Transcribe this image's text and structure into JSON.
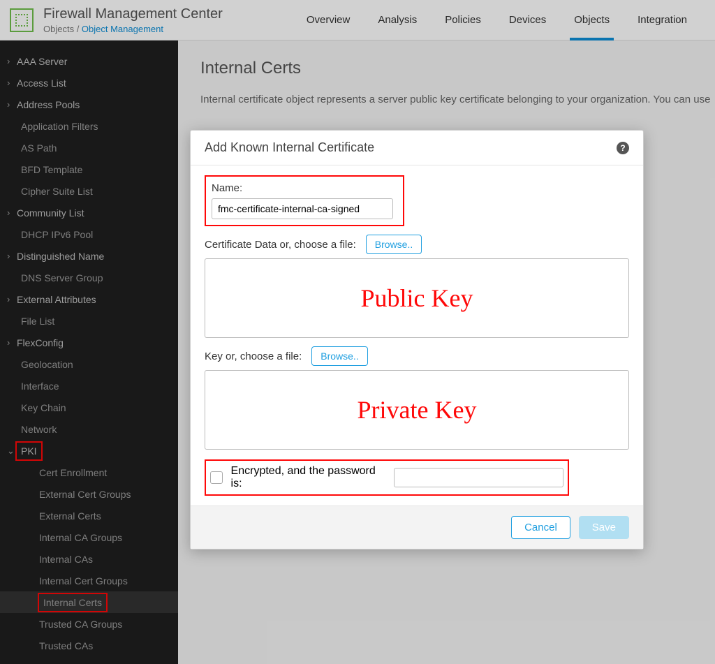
{
  "header": {
    "app_title": "Firewall Management Center",
    "crumb1": "Objects",
    "crumb_sep": " / ",
    "crumb2": "Object Management",
    "tabs": [
      "Overview",
      "Analysis",
      "Policies",
      "Devices",
      "Objects",
      "Integration"
    ],
    "active_tab": "Objects"
  },
  "sidenav": [
    {
      "label": "AAA Server",
      "level": 0,
      "arrow": ">"
    },
    {
      "label": "Access List",
      "level": 0,
      "arrow": ">"
    },
    {
      "label": "Address Pools",
      "level": 0,
      "arrow": ">"
    },
    {
      "label": "Application Filters",
      "level": 1
    },
    {
      "label": "AS Path",
      "level": 1
    },
    {
      "label": "BFD Template",
      "level": 1
    },
    {
      "label": "Cipher Suite List",
      "level": 1
    },
    {
      "label": "Community List",
      "level": 0,
      "arrow": ">"
    },
    {
      "label": "DHCP IPv6 Pool",
      "level": 1
    },
    {
      "label": "Distinguished Name",
      "level": 0,
      "arrow": ">"
    },
    {
      "label": "DNS Server Group",
      "level": 1
    },
    {
      "label": "External Attributes",
      "level": 0,
      "arrow": ">"
    },
    {
      "label": "File List",
      "level": 1
    },
    {
      "label": "FlexConfig",
      "level": 0,
      "arrow": ">"
    },
    {
      "label": "Geolocation",
      "level": 1
    },
    {
      "label": "Interface",
      "level": 1
    },
    {
      "label": "Key Chain",
      "level": 1
    },
    {
      "label": "Network",
      "level": 1
    },
    {
      "label": "PKI",
      "level": 0,
      "arrow": "v",
      "redbox": true
    },
    {
      "label": "Cert Enrollment",
      "level": 2
    },
    {
      "label": "External Cert Groups",
      "level": 2
    },
    {
      "label": "External Certs",
      "level": 2
    },
    {
      "label": "Internal CA Groups",
      "level": 2
    },
    {
      "label": "Internal CAs",
      "level": 2
    },
    {
      "label": "Internal Cert Groups",
      "level": 2
    },
    {
      "label": "Internal Certs",
      "level": 2,
      "selected": true,
      "redbox": true
    },
    {
      "label": "Trusted CA Groups",
      "level": 2
    },
    {
      "label": "Trusted CAs",
      "level": 2
    }
  ],
  "page": {
    "title": "Internal Certs",
    "desc": "Internal certificate object represents a server public key certificate belonging to your organization. You can use"
  },
  "modal": {
    "title": "Add Known Internal Certificate",
    "name_label": "Name:",
    "name_value": "fmc-certificate-internal-ca-signed",
    "cert_label": "Certificate Data or, choose a file:",
    "browse": "Browse..",
    "public_key": "Public Key",
    "key_label": "Key or, choose a file:",
    "private_key": "Private Key",
    "enc_label": "Encrypted, and the password is:",
    "cancel": "Cancel",
    "save": "Save",
    "help": "?"
  }
}
